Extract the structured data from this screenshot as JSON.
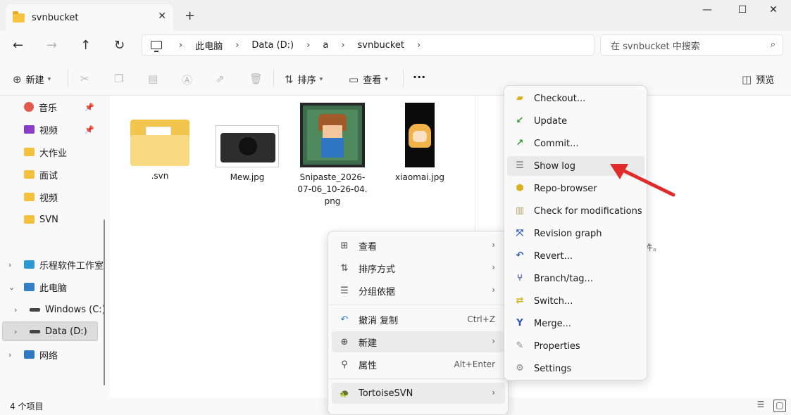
{
  "window": {
    "tab_title": "svnbucket",
    "new_tab": "+",
    "close_tab": "✕",
    "minimize": "—",
    "maximize": "☐",
    "close": "✕"
  },
  "nav": {
    "back": "←",
    "forward": "→",
    "up": "↑",
    "refresh": "↻"
  },
  "breadcrumb": [
    "此电脑",
    "Data (D:)",
    "a",
    "svnbucket"
  ],
  "breadcrumb_sep": "›",
  "search": {
    "placeholder": "在 svnbucket 中搜索",
    "icon": "⌕"
  },
  "toolbar": {
    "new_label": "新建",
    "sort_label": "排序",
    "view_label": "查看",
    "more": "···",
    "preview_label": "预览"
  },
  "sidebar": {
    "items": [
      {
        "label": "音乐",
        "icon": "music-icon",
        "pinned": true
      },
      {
        "label": "视频",
        "icon": "video-icon",
        "pinned": true
      },
      {
        "label": "大作业",
        "icon": "folder-icon"
      },
      {
        "label": "面试",
        "icon": "folder-icon"
      },
      {
        "label": "视频",
        "icon": "folder-icon"
      },
      {
        "label": "SVN",
        "icon": "folder-icon"
      },
      {
        "label": "乐程软件工作室",
        "icon": "cloud-icon"
      },
      {
        "label": "此电脑",
        "icon": "pc-icon"
      },
      {
        "label": "Windows (C:)",
        "icon": "drive-icon"
      },
      {
        "label": "Data (D:)",
        "icon": "drive-icon"
      },
      {
        "label": "网络",
        "icon": "network-icon"
      }
    ]
  },
  "files": [
    {
      "name": ".svn"
    },
    {
      "name": "Mew.jpg"
    },
    {
      "name": "Snipaste_2026-07-06_10-26-04.png"
    },
    {
      "name": "xiaomai.jpg"
    }
  ],
  "empty_msg": "文件。",
  "status": {
    "count": "4 个项目"
  },
  "context_menu": {
    "items": [
      {
        "label": "查看",
        "icon": "⊞",
        "arrow": "›"
      },
      {
        "label": "排序方式",
        "icon": "⇅",
        "arrow": "›"
      },
      {
        "label": "分组依据",
        "icon": "☰",
        "arrow": "›"
      },
      {
        "label": "撤消 复制",
        "icon": "↶",
        "shortcut": "Ctrl+Z"
      },
      {
        "label": "新建",
        "icon": "⊕",
        "arrow": "›"
      },
      {
        "label": "属性",
        "icon": "⚲",
        "shortcut": "Alt+Enter"
      },
      {
        "label": "TortoiseSVN",
        "icon": "🐢",
        "arrow": "›"
      }
    ]
  },
  "svn_menu": {
    "items": [
      {
        "label": "Checkout...",
        "color": "#d7b21a"
      },
      {
        "label": "Update",
        "color": "#2f9a2f"
      },
      {
        "label": "Commit...",
        "color": "#2f9a2f"
      },
      {
        "label": "Show log",
        "color": "#6a6a6a"
      },
      {
        "label": "Repo-browser",
        "color": "#d7b21a"
      },
      {
        "label": "Check for modifications",
        "color": "#b8a46a"
      },
      {
        "label": "Revision graph",
        "color": "#2a56b5"
      },
      {
        "label": "Revert...",
        "color": "#2a56b5"
      },
      {
        "label": "Branch/tag...",
        "color": "#2a56b5"
      },
      {
        "label": "Switch...",
        "color": "#d7b21a"
      },
      {
        "label": "Merge...",
        "color": "#2a56b5"
      },
      {
        "label": "Properties",
        "color": "#8a8a8a"
      },
      {
        "label": "Settings",
        "color": "#8a8a8a"
      }
    ]
  },
  "accent": "#e02b2b"
}
